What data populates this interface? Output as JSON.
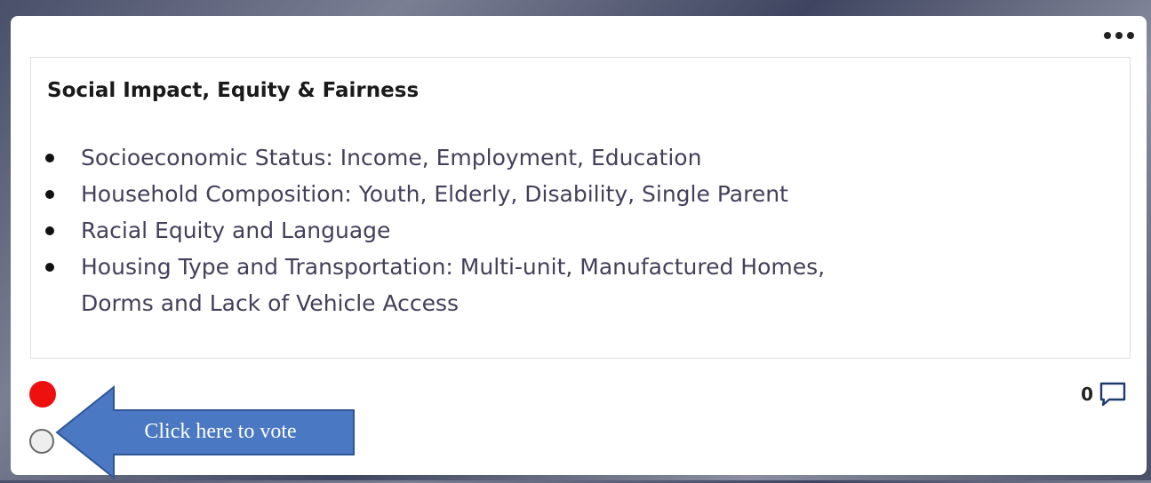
{
  "card": {
    "title": "Social Impact, Equity & Fairness",
    "items": [
      "Socioeconomic Status: Income, Employment, Education",
      "Household Composition: Youth, Elderly, Disability, Single Parent",
      "Racial Equity and Language",
      "Housing Type and Transportation: Multi-unit, Manufactured Homes,",
      "Dorms and Lack of Vehicle Access"
    ],
    "comment_count": "0",
    "vote_dot_color": "#ee0f0f"
  },
  "callout": {
    "text": "Click here to vote",
    "color": "#4a78c2"
  },
  "icons": [
    "more-icon",
    "comment-icon",
    "arrow-left-icon"
  ]
}
